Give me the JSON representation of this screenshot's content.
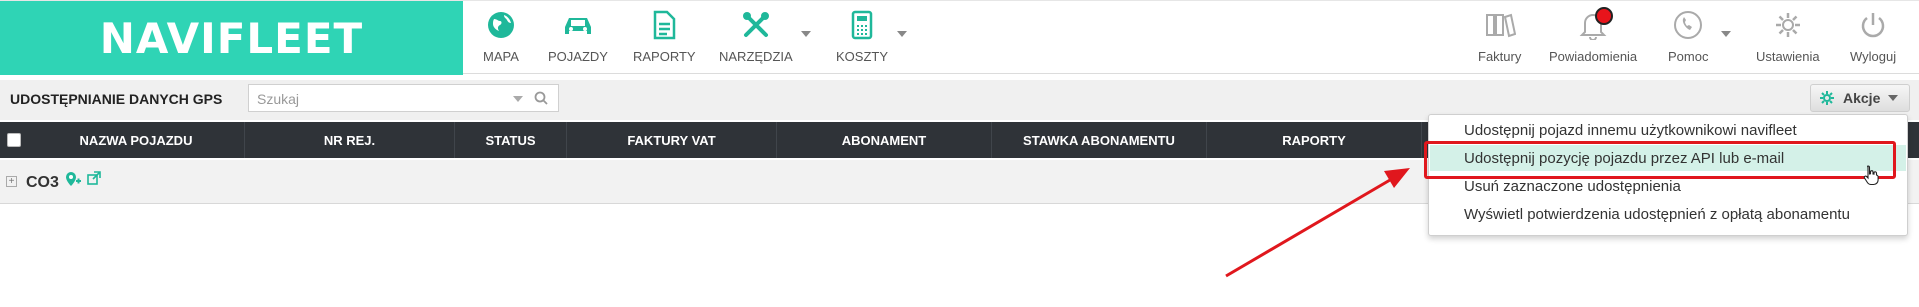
{
  "logo": {
    "text": "NAVIFLEET"
  },
  "nav": [
    {
      "id": "mapa",
      "label": "MAPA",
      "icon": "globe-icon"
    },
    {
      "id": "pojazdy",
      "label": "POJAZDY",
      "icon": "car-icon"
    },
    {
      "id": "raporty",
      "label": "RAPORTY",
      "icon": "document-icon"
    },
    {
      "id": "narzedzia",
      "label": "NARZĘDZIA",
      "icon": "tools-icon",
      "has_dropdown": true
    },
    {
      "id": "koszty",
      "label": "KOSZTY",
      "icon": "calculator-icon",
      "has_dropdown": true
    }
  ],
  "right_nav": [
    {
      "id": "faktury",
      "label": "Faktury",
      "icon": "binders-icon"
    },
    {
      "id": "powiadomienia",
      "label": "Powiadomienia",
      "icon": "bell-icon",
      "has_badge": true
    },
    {
      "id": "pomoc",
      "label": "Pomoc",
      "icon": "phone-icon",
      "has_dropdown": true
    },
    {
      "id": "ustawienia",
      "label": "Ustawienia",
      "icon": "gear-icon"
    },
    {
      "id": "wyloguj",
      "label": "Wyloguj",
      "icon": "power-icon"
    }
  ],
  "toolbar": {
    "title": "UDOSTĘPNIANIE DANYCH GPS",
    "search_placeholder": "Szukaj",
    "actions_label": "Akcje"
  },
  "table": {
    "columns": [
      "NAZWA POJAZDU",
      "NR REJ.",
      "STATUS",
      "FAKTURY VAT",
      "ABONAMENT",
      "STAWKA ABONAMENTU",
      "RAPORTY"
    ],
    "group": {
      "name": "CO3"
    }
  },
  "actions_menu": {
    "items": [
      "Udostępnij pojazd innemu użytkownikowi navifleet",
      "Udostępnij pozycję pojazdu przez API lub e-mail",
      "Usuń zaznaczone udostępnienia",
      "Wyświetl potwierdzenia udostępnień z opłatą abonamentu"
    ],
    "highlighted_index": 1
  },
  "colors": {
    "brand": "#2fd4b5",
    "accent": "#1fb89a",
    "header_bg": "#2f3338",
    "highlight": "#d4f1e8",
    "annotation": "#e0171d"
  }
}
